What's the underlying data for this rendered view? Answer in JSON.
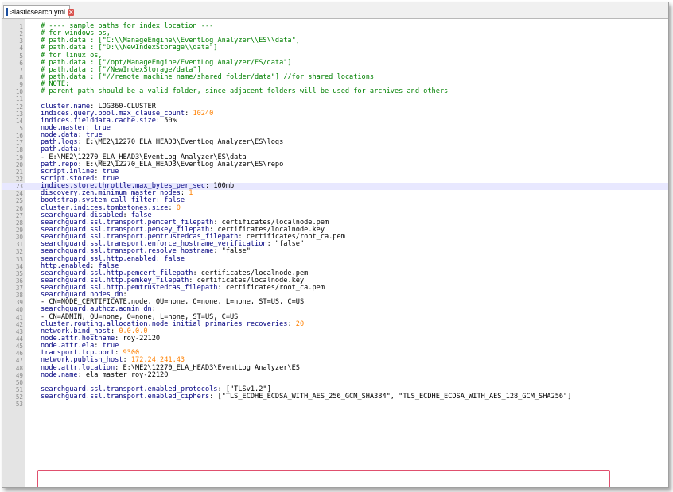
{
  "tab": {
    "filename": "elasticsearch.yml",
    "close_glyph": "✕"
  },
  "current_line": 23,
  "highlighted_lines": [
    51,
    52
  ],
  "lines": [
    {
      "n": "1",
      "parts": [
        {
          "t": "# ---- sample paths for index location ---",
          "c": "comment"
        }
      ]
    },
    {
      "n": "2",
      "parts": [
        {
          "t": "# for windows os,",
          "c": "comment"
        }
      ]
    },
    {
      "n": "3",
      "parts": [
        {
          "t": "# path.data : [\"C:\\\\ManageEngine\\\\EventLog Analyzer\\\\ES\\\\data\"]",
          "c": "comment"
        }
      ]
    },
    {
      "n": "4",
      "parts": [
        {
          "t": "# path.data : [\"D:\\\\NewIndexStorage\\\\data\"]",
          "c": "comment"
        }
      ]
    },
    {
      "n": "5",
      "parts": [
        {
          "t": "# for linux os,",
          "c": "comment"
        }
      ]
    },
    {
      "n": "6",
      "parts": [
        {
          "t": "# path.data : [\"/opt/ManageEngine/EventLog Analyzer/ES/data\"]",
          "c": "comment"
        }
      ]
    },
    {
      "n": "7",
      "parts": [
        {
          "t": "# path.data : [\"/NewIndexStorage/data\"]",
          "c": "comment"
        }
      ]
    },
    {
      "n": "8",
      "parts": [
        {
          "t": "# path.data : [\"//remote machine name/shared folder/data\"] //for shared locations",
          "c": "comment"
        }
      ]
    },
    {
      "n": "9",
      "parts": [
        {
          "t": "# NOTE:",
          "c": "comment"
        }
      ]
    },
    {
      "n": "10",
      "parts": [
        {
          "t": "# parent path should be a valid folder, since adjacent folders will be used for archives and others",
          "c": "comment"
        }
      ]
    },
    {
      "n": "11",
      "parts": []
    },
    {
      "n": "12",
      "parts": [
        {
          "t": "cluster.name",
          "c": "key"
        },
        {
          "t": ": LOG360-CLUSTER",
          "c": "plain"
        }
      ]
    },
    {
      "n": "13",
      "parts": [
        {
          "t": "indices.query.bool.max_clause_count",
          "c": "key"
        },
        {
          "t": ": ",
          "c": "plain"
        },
        {
          "t": "10240",
          "c": "num"
        }
      ]
    },
    {
      "n": "14",
      "parts": [
        {
          "t": "indices.fielddata.cache.size",
          "c": "key"
        },
        {
          "t": ": 50%",
          "c": "plain"
        }
      ]
    },
    {
      "n": "15",
      "parts": [
        {
          "t": "node.master",
          "c": "key"
        },
        {
          "t": ": ",
          "c": "plain"
        },
        {
          "t": "true",
          "c": "bool"
        }
      ]
    },
    {
      "n": "16",
      "parts": [
        {
          "t": "node.data",
          "c": "key"
        },
        {
          "t": ": ",
          "c": "plain"
        },
        {
          "t": "true",
          "c": "bool"
        }
      ]
    },
    {
      "n": "17",
      "parts": [
        {
          "t": "path.logs",
          "c": "key"
        },
        {
          "t": ": E:\\ME2\\12270_ELA_HEAD3\\EventLog Analyzer\\ES\\logs",
          "c": "plain"
        }
      ]
    },
    {
      "n": "18",
      "parts": [
        {
          "t": "path.data",
          "c": "key"
        },
        {
          "t": ":",
          "c": "plain"
        }
      ]
    },
    {
      "n": "19",
      "parts": [
        {
          "t": "- E:\\ME2\\12270_ELA_HEAD3\\EventLog Analyzer\\ES\\data",
          "c": "plain"
        }
      ]
    },
    {
      "n": "20",
      "parts": [
        {
          "t": "path.repo",
          "c": "key"
        },
        {
          "t": ": E:\\ME2\\12270_ELA_HEAD3\\EventLog Analyzer\\ES\\repo",
          "c": "plain"
        }
      ]
    },
    {
      "n": "21",
      "parts": [
        {
          "t": "script.inline",
          "c": "key"
        },
        {
          "t": ": ",
          "c": "plain"
        },
        {
          "t": "true",
          "c": "bool"
        }
      ]
    },
    {
      "n": "22",
      "parts": [
        {
          "t": "script.stored",
          "c": "key"
        },
        {
          "t": ": ",
          "c": "plain"
        },
        {
          "t": "true",
          "c": "bool"
        }
      ]
    },
    {
      "n": "23",
      "parts": [
        {
          "t": "indices.store.throttle.max_bytes_per_sec",
          "c": "key"
        },
        {
          "t": ": 100mb",
          "c": "plain"
        }
      ]
    },
    {
      "n": "24",
      "parts": [
        {
          "t": "discovery.zen.minimum_master_nodes",
          "c": "key"
        },
        {
          "t": ": ",
          "c": "plain"
        },
        {
          "t": "1",
          "c": "num"
        }
      ]
    },
    {
      "n": "25",
      "parts": [
        {
          "t": "bootstrap.system_call_filter",
          "c": "key"
        },
        {
          "t": ": ",
          "c": "plain"
        },
        {
          "t": "false",
          "c": "bool"
        }
      ]
    },
    {
      "n": "26",
      "parts": [
        {
          "t": "cluster.indices.tombstones.size",
          "c": "key"
        },
        {
          "t": ": ",
          "c": "plain"
        },
        {
          "t": "0",
          "c": "num"
        }
      ]
    },
    {
      "n": "27",
      "parts": [
        {
          "t": "searchguard.disabled",
          "c": "key"
        },
        {
          "t": ": ",
          "c": "plain"
        },
        {
          "t": "false",
          "c": "bool"
        }
      ]
    },
    {
      "n": "28",
      "parts": [
        {
          "t": "searchguard.ssl.transport.pemcert_filepath",
          "c": "key"
        },
        {
          "t": ": certificates/localnode.pem",
          "c": "plain"
        }
      ]
    },
    {
      "n": "29",
      "parts": [
        {
          "t": "searchguard.ssl.transport.pemkey_filepath",
          "c": "key"
        },
        {
          "t": ": certificates/localnode.key",
          "c": "plain"
        }
      ]
    },
    {
      "n": "30",
      "parts": [
        {
          "t": "searchguard.ssl.transport.pemtrustedcas_filepath",
          "c": "key"
        },
        {
          "t": ": certificates/root_ca.pem",
          "c": "plain"
        }
      ]
    },
    {
      "n": "31",
      "parts": [
        {
          "t": "searchguard.ssl.transport.enforce_hostname_verification",
          "c": "key"
        },
        {
          "t": ": \"false\"",
          "c": "plain"
        }
      ]
    },
    {
      "n": "32",
      "parts": [
        {
          "t": "searchguard.ssl.transport.resolve_hostname",
          "c": "key"
        },
        {
          "t": ": \"false\"",
          "c": "plain"
        }
      ]
    },
    {
      "n": "33",
      "parts": [
        {
          "t": "searchguard.ssl.http.enabled",
          "c": "key"
        },
        {
          "t": ": ",
          "c": "plain"
        },
        {
          "t": "false",
          "c": "bool"
        }
      ]
    },
    {
      "n": "34",
      "parts": [
        {
          "t": "http.enabled",
          "c": "key"
        },
        {
          "t": ": ",
          "c": "plain"
        },
        {
          "t": "false",
          "c": "bool"
        }
      ]
    },
    {
      "n": "35",
      "parts": [
        {
          "t": "searchguard.ssl.http.pemcert_filepath",
          "c": "key"
        },
        {
          "t": ": certificates/localnode.pem",
          "c": "plain"
        }
      ]
    },
    {
      "n": "36",
      "parts": [
        {
          "t": "searchguard.ssl.http.pemkey_filepath",
          "c": "key"
        },
        {
          "t": ": certificates/localnode.key",
          "c": "plain"
        }
      ]
    },
    {
      "n": "37",
      "parts": [
        {
          "t": "searchguard.ssl.http.pemtrustedcas_filepath",
          "c": "key"
        },
        {
          "t": ": certificates/root_ca.pem",
          "c": "plain"
        }
      ]
    },
    {
      "n": "38",
      "parts": [
        {
          "t": "searchguard.nodes_dn",
          "c": "key"
        },
        {
          "t": ":",
          "c": "plain"
        }
      ]
    },
    {
      "n": "39",
      "parts": [
        {
          "t": "- CN=NODE_CERTIFICATE.node, OU=none, O=none, L=none, ST=US, C=US",
          "c": "plain"
        }
      ]
    },
    {
      "n": "40",
      "parts": [
        {
          "t": "searchguard.authcz.admin_dn",
          "c": "key"
        },
        {
          "t": ":",
          "c": "plain"
        }
      ]
    },
    {
      "n": "41",
      "parts": [
        {
          "t": "- CN=ADMIN, OU=none, O=none, L=none, ST=US, C=US",
          "c": "plain"
        }
      ]
    },
    {
      "n": "42",
      "parts": [
        {
          "t": "cluster.routing.allocation.node_initial_primaries_recoveries",
          "c": "key"
        },
        {
          "t": ": ",
          "c": "plain"
        },
        {
          "t": "20",
          "c": "num"
        }
      ]
    },
    {
      "n": "43",
      "parts": [
        {
          "t": "network.bind_host",
          "c": "key"
        },
        {
          "t": ": ",
          "c": "plain"
        },
        {
          "t": "0.0.0.0",
          "c": "num"
        }
      ]
    },
    {
      "n": "44",
      "parts": [
        {
          "t": "node.attr.hostname",
          "c": "key"
        },
        {
          "t": ": roy-22120",
          "c": "plain"
        }
      ]
    },
    {
      "n": "45",
      "parts": [
        {
          "t": "node.attr.ela",
          "c": "key"
        },
        {
          "t": ": ",
          "c": "plain"
        },
        {
          "t": "true",
          "c": "bool"
        }
      ]
    },
    {
      "n": "46",
      "parts": [
        {
          "t": "transport.tcp.port",
          "c": "key"
        },
        {
          "t": ": ",
          "c": "plain"
        },
        {
          "t": "9300",
          "c": "num"
        }
      ]
    },
    {
      "n": "47",
      "parts": [
        {
          "t": "network.publish_host",
          "c": "key"
        },
        {
          "t": ": ",
          "c": "plain"
        },
        {
          "t": "172.24.241.43",
          "c": "num"
        }
      ]
    },
    {
      "n": "48",
      "parts": [
        {
          "t": "node.attr.location",
          "c": "key"
        },
        {
          "t": ": E:\\ME2\\12270_ELA_HEAD3\\EventLog Analyzer\\ES",
          "c": "plain"
        }
      ]
    },
    {
      "n": "49",
      "parts": [
        {
          "t": "node.name",
          "c": "key"
        },
        {
          "t": ": ela_master_roy-22120",
          "c": "plain"
        }
      ]
    },
    {
      "n": "50",
      "parts": []
    },
    {
      "n": "51",
      "parts": [
        {
          "t": "searchguard.ssl.transport.enabled_protocols",
          "c": "key"
        },
        {
          "t": ": [\"TLSv1.2\"]",
          "c": "plain"
        }
      ]
    },
    {
      "n": "52",
      "parts": [
        {
          "t": "searchguard.ssl.transport.enabled_ciphers",
          "c": "key"
        },
        {
          "t": ": [\"TLS_ECDHE_ECDSA_WITH_AES_256_GCM_SHA384\", \"TLS_ECDHE_ECDSA_WITH_AES_128_GCM_SHA256\"]",
          "c": "plain"
        }
      ]
    },
    {
      "n": "53",
      "parts": []
    }
  ]
}
